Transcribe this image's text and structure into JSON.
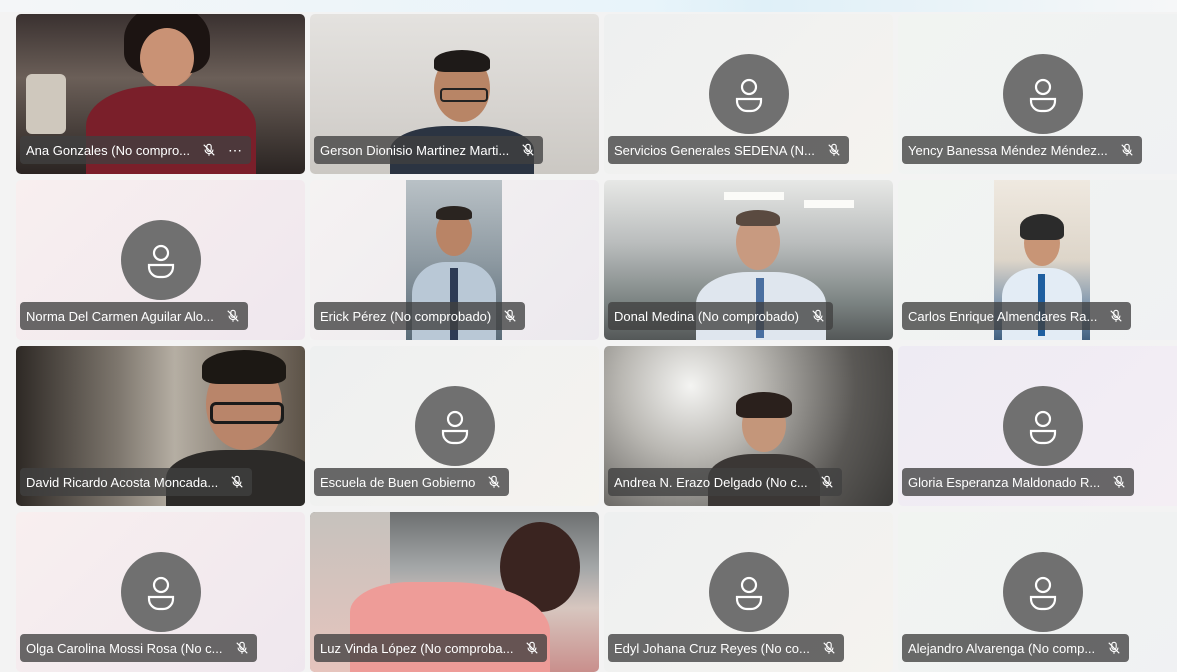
{
  "meeting": {
    "participants": [
      {
        "name": "Ana Gonzales (No compro...",
        "video": "ana",
        "show_more": true,
        "more_label": "⋯"
      },
      {
        "name": "Gerson Dionisio Martinez Marti...",
        "video": "gerson"
      },
      {
        "name": "Servicios Generales SEDENA (N...",
        "video": null
      },
      {
        "name": "Yency Banessa Méndez Méndez...",
        "video": null
      },
      {
        "name": "Norma Del Carmen Aguilar Alo...",
        "video": null
      },
      {
        "name": "Erick Pérez (No comprobado)",
        "video": "erick"
      },
      {
        "name": "Donal Medina (No comprobado)",
        "video": "donal"
      },
      {
        "name": "Carlos Enrique Almendares Ra...",
        "video": "carlos"
      },
      {
        "name": "David Ricardo Acosta Moncada...",
        "video": "david"
      },
      {
        "name": "Escuela de Buen Gobierno",
        "video": null
      },
      {
        "name": "Andrea N. Erazo Delgado (No c...",
        "video": "andrea"
      },
      {
        "name": "Gloria Esperanza Maldonado R...",
        "video": null
      },
      {
        "name": "Olga Carolina Mossi Rosa (No c...",
        "video": null
      },
      {
        "name": "Luz Vinda López (No comproba...",
        "video": "luz"
      },
      {
        "name": "Edyl Johana Cruz Reyes (No co...",
        "video": null
      },
      {
        "name": "Alejandro Alvarenga (No comp...",
        "video": null
      }
    ],
    "mic_state": "muted",
    "avatar_icon": "person-icon",
    "colors": {
      "avatar": "#707070",
      "name_tag": "#404040",
      "tile_background": "#f2f0f0"
    }
  }
}
